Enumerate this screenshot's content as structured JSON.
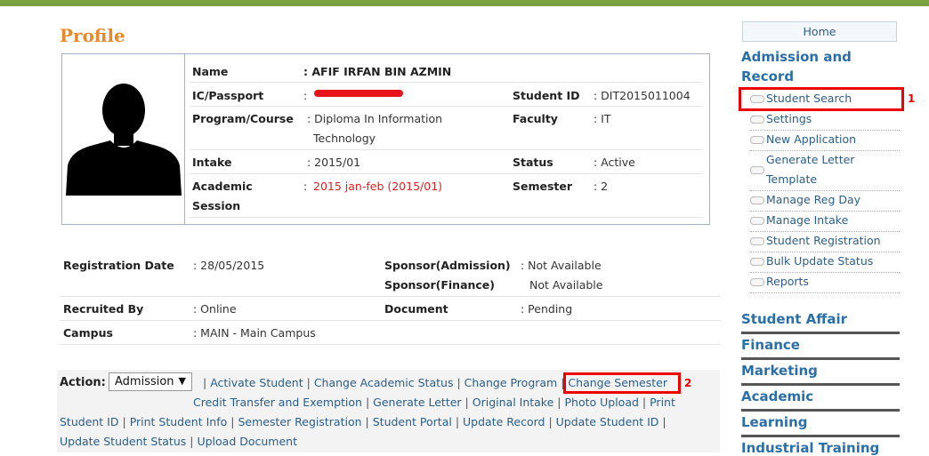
{
  "page": {
    "title": "Profile"
  },
  "student": {
    "name_label": "Name",
    "name": ": AFIF IRFAN BIN AZMIN",
    "ic_label": "IC/Passport",
    "ic_colon": ":",
    "id_label": "Student ID",
    "id": ": DIT2015011004",
    "program_label": "Program/Course",
    "program_line1": ": Diploma In Information",
    "program_line2": "Technology",
    "faculty_label": "Faculty",
    "faculty": ": IT",
    "intake_label": "Intake",
    "intake": ": 2015/01",
    "status_label": "Status",
    "status": ": Active",
    "session_label1": "Academic",
    "session_label2": "Session",
    "session_colon": ":",
    "session": "2015 jan-feb (2015/01)",
    "semester_label": "Semester",
    "semester": ": 2"
  },
  "registration": {
    "date_label": "Registration Date",
    "date": ": 28/05/2015",
    "sponsor_adm_label": "Sponsor(Admission)",
    "sponsor_adm": ": Not Available",
    "sponsor_fin_label": "Sponsor(Finance)",
    "sponsor_fin": "Not Available",
    "recruited_label": "Recruited By",
    "recruited": ": Online",
    "document_label": "Document",
    "document": ": Pending",
    "campus_label": "Campus",
    "campus": ": MAIN - Main Campus"
  },
  "actions": {
    "label": "Action:",
    "selected": "Admission",
    "links": {
      "activate": "Activate Student",
      "change_status": "Change Academic Status",
      "change_program": "Change Program",
      "change_semester": "Change Semester",
      "credit_transfer": "Credit Transfer and Exemption",
      "generate_letter": "Generate Letter",
      "original_intake": "Original Intake",
      "photo_upload": "Photo Upload",
      "print": "Print",
      "student_id": "Student ID",
      "print_info": "Print Student Info",
      "sem_reg": "Semester Registration",
      "portal": "Student Portal",
      "update_record": "Update Record",
      "update_id": "Update Student ID",
      "update_status": "Update Student Status",
      "upload_doc": "Upload Document"
    },
    "sep": "|"
  },
  "annotations": {
    "one": "1",
    "two": "2"
  },
  "sidebar": {
    "home": "Home",
    "admission_line1": "Admission and",
    "admission_line2": "Record",
    "items": [
      "Student Search",
      "Settings",
      "New Application",
      "Generate Letter",
      "Template",
      "Manage Reg Day",
      "Manage Intake",
      "Student Registration",
      "Bulk Update Status",
      "Reports"
    ],
    "sections": [
      "Student Affair",
      "Finance",
      "Marketing",
      "Academic",
      "Learning",
      "Industrial Training"
    ]
  },
  "colors": {
    "accent_green": "#7ba23f",
    "title_orange": "#e8892c",
    "link_blue": "#2a5e8a",
    "highlight_red": "#e00000"
  }
}
